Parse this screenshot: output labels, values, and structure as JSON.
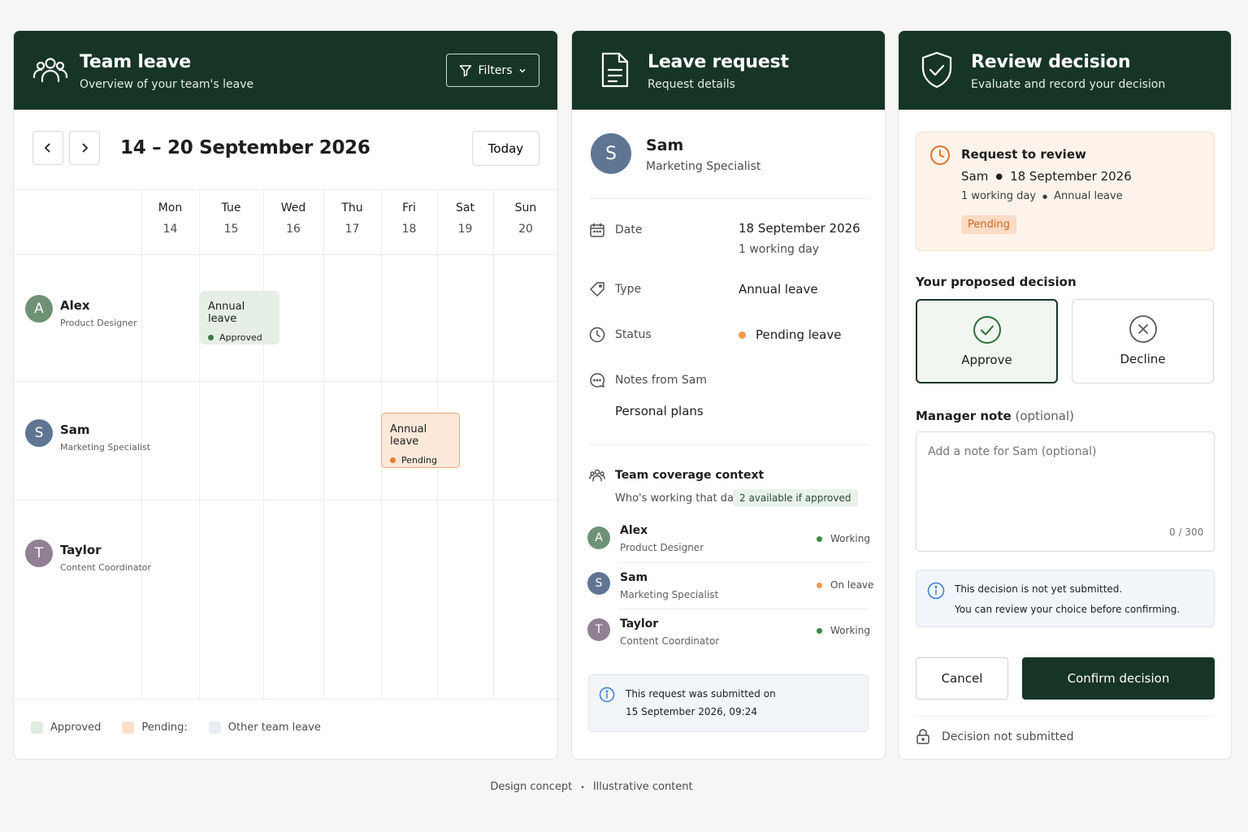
{
  "calendar": {
    "title": "Team leave",
    "subtitle": "Overview of your team's leave",
    "filters_label": "Filters",
    "week_range": "14 – 20 September 2026",
    "today_label": "Today",
    "days": [
      {
        "name": "Mon",
        "date": "14"
      },
      {
        "name": "Tue",
        "date": "15"
      },
      {
        "name": "Wed",
        "date": "16"
      },
      {
        "name": "Thu",
        "date": "17"
      },
      {
        "name": "Fri",
        "date": "18"
      },
      {
        "name": "Sat",
        "date": "19"
      },
      {
        "name": "Sun",
        "date": "20"
      }
    ],
    "people": [
      {
        "initial": "A",
        "name": "Alex",
        "role": "Product Designer",
        "color": "#6f9277"
      },
      {
        "initial": "S",
        "name": "Sam",
        "role": "Marketing Specialist",
        "color": "#5f7593"
      },
      {
        "initial": "T",
        "name": "Taylor",
        "role": "Content Coordinator",
        "color": "#917f93"
      }
    ],
    "leave_blocks": [
      {
        "title": "Annual leave",
        "status": "Approved"
      },
      {
        "title": "Annual leave",
        "status": "Pending"
      }
    ],
    "legend": [
      "Approved",
      "Pending:",
      "Other team leave"
    ],
    "colors": {
      "approved_bg": "#e6efe5",
      "approved_dot": "#3d7a45",
      "pending_bg": "#fce8d9",
      "pending_border": "#f1a577",
      "pending_dot": "#ee7a2b",
      "other": "#e9edf3"
    }
  },
  "request": {
    "title": "Leave request",
    "subtitle": "Request details",
    "employee": {
      "initial": "S",
      "name": "Sam",
      "role": "Marketing Specialist"
    },
    "date_label": "Date",
    "date_value": "18 September 2026",
    "date_sub": "1 working day",
    "type_label": "Type",
    "type_value": "Annual leave",
    "status_label": "Status",
    "status_value": "Pending leave",
    "notes_label": "Notes from Sam",
    "notes_value": "Personal plans",
    "coverage_title": "Team coverage context",
    "coverage_sub": "Who's working that day",
    "coverage_chip": "2 available if approved",
    "coverage": [
      {
        "initial": "A",
        "name": "Alex",
        "role": "Product Designer",
        "status": "Working",
        "color": "#6f9277",
        "dot": "#3d8a46"
      },
      {
        "initial": "S",
        "name": "Sam",
        "role": "Marketing Specialist",
        "status": "On leave",
        "color": "#5f7593",
        "dot": "#f29a4a"
      },
      {
        "initial": "T",
        "name": "Taylor",
        "role": "Content Coordinator",
        "status": "Working",
        "color": "#917f93",
        "dot": "#3d8a46"
      }
    ],
    "submitted_line1": "This request was submitted on",
    "submitted_line2": "15 September 2026, 09:24"
  },
  "review": {
    "title": "Review decision",
    "subtitle": "Evaluate and record your decision",
    "card_title": "Request to review",
    "card_who": "Sam",
    "card_date": "18 September 2026",
    "card_days": "1 working day",
    "card_type": "Annual leave",
    "card_status": "Pending",
    "proposed_label": "Your proposed decision",
    "approve_label": "Approve",
    "decline_label": "Decline",
    "note_label": "Manager note",
    "note_optional": "(optional)",
    "note_placeholder": "Add a note for Sam (optional)",
    "note_counter": "0 / 300",
    "info_line1": "This decision is not yet submitted.",
    "info_line2": "You can review your choice before confirming.",
    "cancel_label": "Cancel",
    "confirm_label": "Confirm decision",
    "lock_text": "Decision not submitted"
  },
  "footer": {
    "left": "Design concept",
    "sep": "•",
    "right": "Illustrative content"
  }
}
